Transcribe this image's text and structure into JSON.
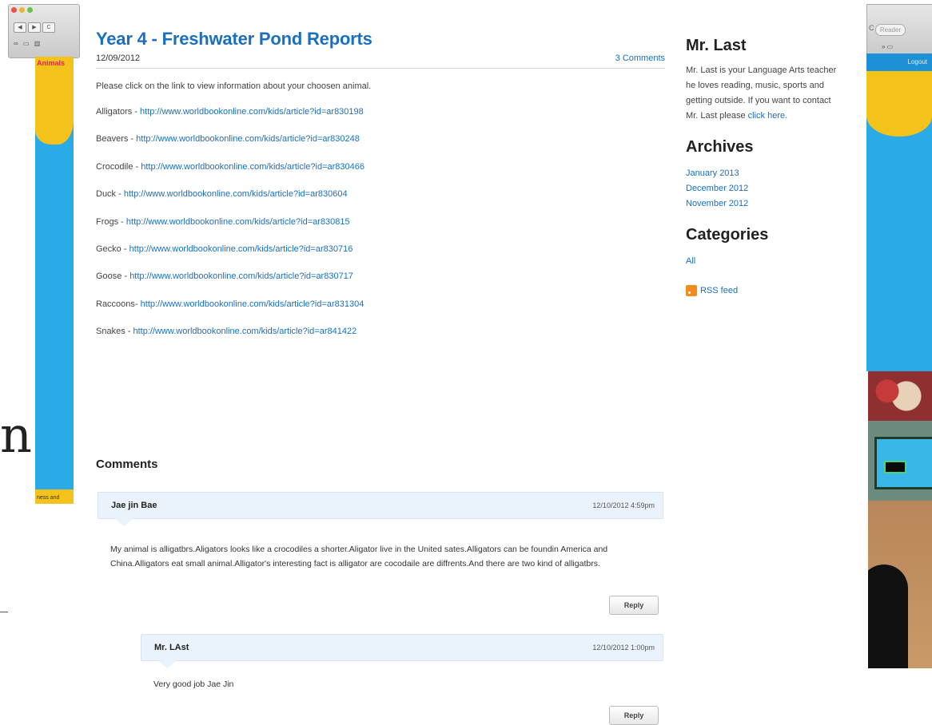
{
  "post": {
    "title": "Year 4 - Freshwater Pond Reports",
    "date": "12/09/2012",
    "comments_link": "3 Comments",
    "intro": "Please click on the link to view information about your choosen animal.",
    "animals": [
      {
        "name": "Alligators - ",
        "url": "http://www.worldbookonline.com/kids/article?id=ar830198"
      },
      {
        "name": "Beavers - ",
        "url": "http://www.worldbookonline.com/kids/article?id=ar830248"
      },
      {
        "name": "Crocodile - ",
        "url": "http://www.worldbookonline.com/kids/article?id=ar830466"
      },
      {
        "name": "Duck - ",
        "url": "http://www.worldbookonline.com/kids/article?id=ar830604"
      },
      {
        "name": "Frogs - ",
        "url": "http://www.worldbookonline.com/kids/article?id=ar830815"
      },
      {
        "name": "Gecko - ",
        "url": "http://www.worldbookonline.com/kids/article?id=ar830716"
      },
      {
        "name": "Goose - ",
        "url": "http://www.worldbookonline.com/kids/article?id=ar830717"
      },
      {
        "name": "Raccoons- ",
        "url": "http://www.worldbookonline.com/kids/article?id=ar831304"
      },
      {
        "name": "Snakes - ",
        "url": "http://www.worldbookonline.com/kids/article?id=ar841422"
      }
    ]
  },
  "comments": {
    "heading": "Comments",
    "items": [
      {
        "author": "Jae jin Bae",
        "date": "12/10/2012 4:59pm",
        "text": "My animal is alligatbrs.Aligators looks like a crocodiles a shorter.Aligator live in the United sates.Alligators can be foundin America and China.Alligators eat small animal.Alligator's interesting fact is alligator are cocodaile are diffrents.And there are two kind of alligatbrs.",
        "reply": "Reply"
      },
      {
        "author": "Mr. LAst",
        "date": "12/10/2012 1:00pm",
        "text": "Very good job Jae Jin",
        "reply": "Reply"
      }
    ]
  },
  "sidebar": {
    "author_heading": "Mr. Last",
    "bio": "Mr. Last is your Language Arts teacher he loves reading, music, sports and getting outside. If you want to contact Mr. Last please",
    "bio_link": "click here.",
    "archives_heading": "Archives",
    "archives": [
      "January 2013",
      "December 2012",
      "November 2012"
    ],
    "categories_heading": "Categories",
    "categories": [
      "All"
    ],
    "rss_label": "RSS feed"
  },
  "background": {
    "left_window": {
      "nav_back": "◀",
      "nav_forward": "▶",
      "nav_c": "C",
      "bookmarks": "∞ ▭ ▥",
      "tag_top": "Animals",
      "tag_bottom": "ness and"
    },
    "right_window": {
      "c_glyph": "C",
      "reader": "Reader",
      "bookmarks": "» ▭",
      "logout": "Logout"
    },
    "letter": "n"
  },
  "colors": {
    "link": "#1a6fbe",
    "accent_blue": "#2aabe8",
    "accent_yellow": "#f3c21b",
    "bubble": "#eaf3fb"
  }
}
